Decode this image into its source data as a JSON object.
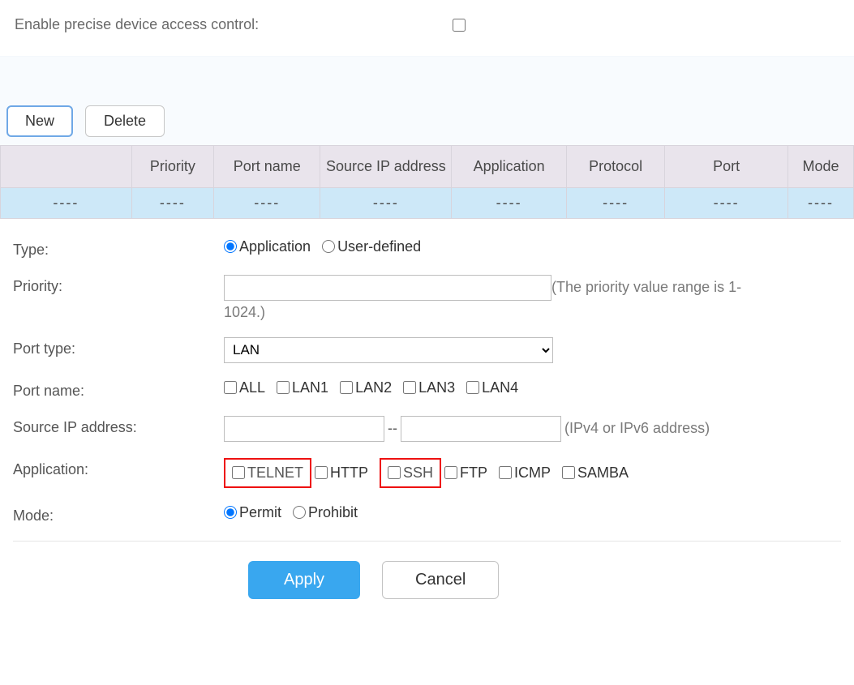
{
  "enable_label": "Enable precise device access control:",
  "toolbar": {
    "new": "New",
    "delete": "Delete"
  },
  "columns": {
    "c0": "",
    "c1": "Priority",
    "c2": "Port name",
    "c3": "Source IP address",
    "c4": "Application",
    "c5": "Protocol",
    "c6": "Port",
    "c7": "Mode"
  },
  "empty_cell": "----",
  "form": {
    "type_label": "Type:",
    "type_app": "Application",
    "type_user": "User-defined",
    "priority_label": "Priority:",
    "priority_hint_a": "(The priority value range is 1-",
    "priority_hint_b": "1024.)",
    "porttype_label": "Port type:",
    "porttype_value": "LAN",
    "portname_label": "Port name:",
    "pn_all": "ALL",
    "pn_lan1": "LAN1",
    "pn_lan2": "LAN2",
    "pn_lan3": "LAN3",
    "pn_lan4": "LAN4",
    "srcip_label": "Source IP address:",
    "srcip_sep": "--",
    "srcip_hint": "(IPv4 or IPv6 address)",
    "application_label": "Application:",
    "app_telnet": "TELNET",
    "app_http": "HTTP",
    "app_ssh": "SSH",
    "app_ftp": "FTP",
    "app_icmp": "ICMP",
    "app_samba": "SAMBA",
    "mode_label": "Mode:",
    "mode_permit": "Permit",
    "mode_prohibit": "Prohibit"
  },
  "actions": {
    "apply": "Apply",
    "cancel": "Cancel"
  }
}
